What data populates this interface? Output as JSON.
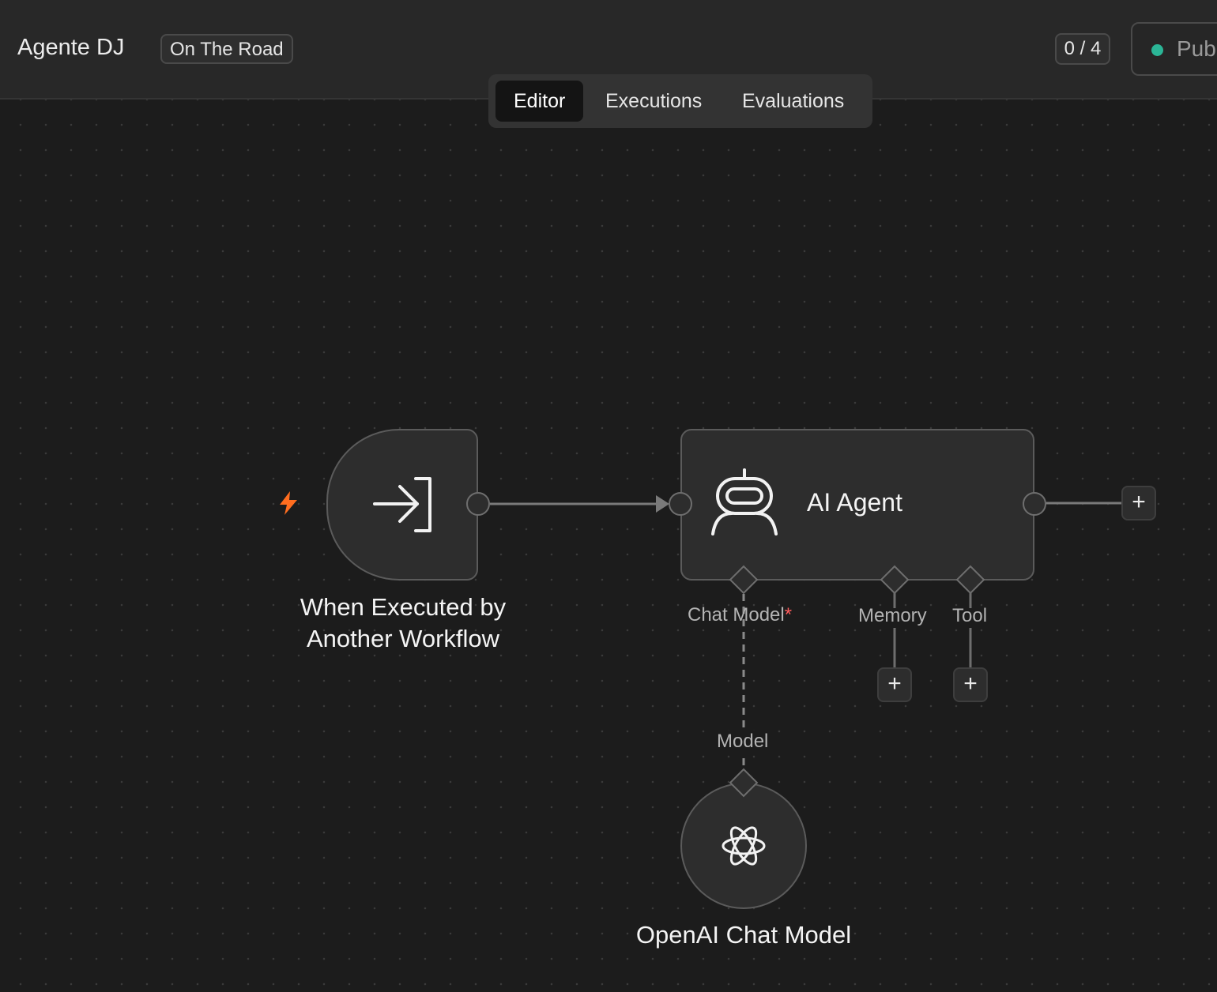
{
  "header": {
    "workflow_name": "Agente DJ",
    "tag": "On The Road",
    "counter": "0 / 4",
    "publish_label": "Pub",
    "publish_status_color": "#2bb596"
  },
  "tabs": [
    {
      "label": "Editor",
      "active": true
    },
    {
      "label": "Executions",
      "active": false
    },
    {
      "label": "Evaluations",
      "active": false
    }
  ],
  "nodes": {
    "trigger": {
      "line1": "When Executed by",
      "line2": "Another Workflow",
      "icon": "sign-in-arrow-icon",
      "badge_icon": "lightning-bolt-icon",
      "badge_color": "#ff6d1f"
    },
    "agent": {
      "title": "AI Agent",
      "icon": "robot-icon"
    },
    "model": {
      "title": "OpenAI Chat Model",
      "icon": "openai-logo-icon"
    }
  },
  "ports": {
    "chat_model": "Chat Model",
    "chat_model_required": "*",
    "memory": "Memory",
    "tool": "Tool",
    "model": "Model"
  },
  "add_button": "+"
}
